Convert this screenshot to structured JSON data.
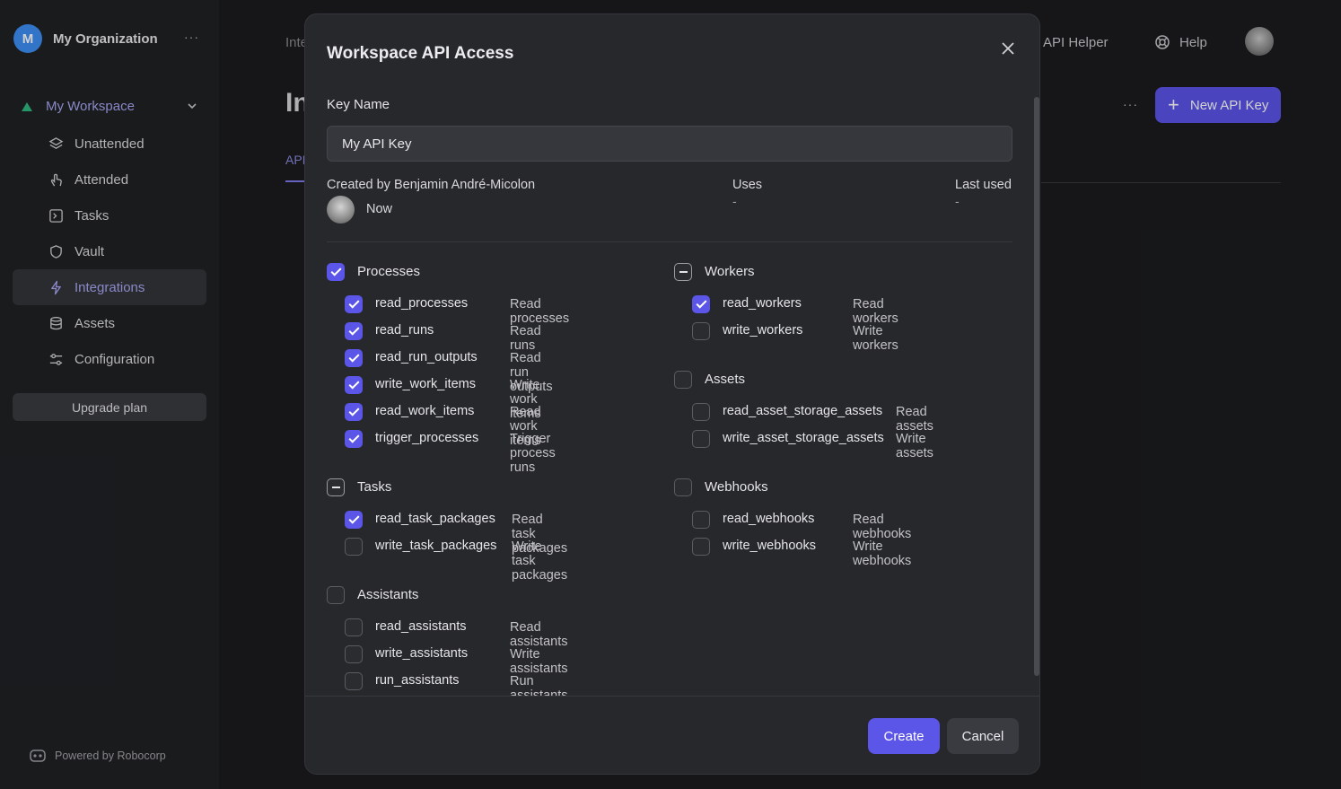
{
  "sidebar": {
    "org_initial": "M",
    "org_name": "My Organization",
    "org_more": "···",
    "workspace": "My Workspace",
    "items": [
      {
        "label": "Unattended",
        "icon": "layers-icon"
      },
      {
        "label": "Attended",
        "icon": "hand-pointer-icon"
      },
      {
        "label": "Tasks",
        "icon": "terminal-icon"
      },
      {
        "label": "Vault",
        "icon": "shield-icon"
      },
      {
        "label": "Integrations",
        "icon": "lightning-icon",
        "active": true
      },
      {
        "label": "Assets",
        "icon": "database-icon"
      },
      {
        "label": "Configuration",
        "icon": "sliders-icon"
      }
    ],
    "upgrade_label": "Upgrade plan",
    "powered_by": "Powered by Robocorp"
  },
  "background": {
    "tab_fragment": "Inte",
    "title_fragment": "In",
    "subtab_fragment": "API",
    "api_helper": "API Helper",
    "help": "Help",
    "more": "···",
    "new_key": "New API Key"
  },
  "modal": {
    "title": "Workspace API Access",
    "key_name_label": "Key Name",
    "key_name_value": "My API Key",
    "created_by": "Created by Benjamin André-Micolon",
    "created_when": "Now",
    "uses_label": "Uses",
    "uses_value": "-",
    "last_used_label": "Last used",
    "last_used_value": "-",
    "groups": {
      "processes": {
        "title": "Processes",
        "state": "checked",
        "perms": [
          {
            "name": "read_processes",
            "desc": "Read processes",
            "checked": true
          },
          {
            "name": "read_runs",
            "desc": "Read runs",
            "checked": true
          },
          {
            "name": "read_run_outputs",
            "desc": "Read run outputs",
            "checked": true
          },
          {
            "name": "write_work_items",
            "desc": "Write work items",
            "checked": true
          },
          {
            "name": "read_work_items",
            "desc": "Read work items",
            "checked": true
          },
          {
            "name": "trigger_processes",
            "desc": "Trigger process runs",
            "checked": true
          }
        ]
      },
      "tasks": {
        "title": "Tasks",
        "state": "indeterminate",
        "perms": [
          {
            "name": "read_task_packages",
            "desc": "Read task packages",
            "checked": true
          },
          {
            "name": "write_task_packages",
            "desc": "Write task packages",
            "checked": false
          }
        ]
      },
      "assistants": {
        "title": "Assistants",
        "state": "unchecked",
        "perms": [
          {
            "name": "read_assistants",
            "desc": "Read assistants",
            "checked": false
          },
          {
            "name": "write_assistants",
            "desc": "Write assistants",
            "checked": false
          },
          {
            "name": "run_assistants",
            "desc": "Run assistants",
            "checked": false
          }
        ]
      },
      "workers": {
        "title": "Workers",
        "state": "indeterminate",
        "perms": [
          {
            "name": "read_workers",
            "desc": "Read workers",
            "checked": true
          },
          {
            "name": "write_workers",
            "desc": "Write workers",
            "checked": false
          }
        ]
      },
      "assets": {
        "title": "Assets",
        "state": "unchecked",
        "perms": [
          {
            "name": "read_asset_storage_assets",
            "desc": "Read assets",
            "checked": false
          },
          {
            "name": "write_asset_storage_assets",
            "desc": "Write assets",
            "checked": false
          }
        ]
      },
      "webhooks": {
        "title": "Webhooks",
        "state": "unchecked",
        "perms": [
          {
            "name": "read_webhooks",
            "desc": "Read webhooks",
            "checked": false
          },
          {
            "name": "write_webhooks",
            "desc": "Write webhooks",
            "checked": false
          }
        ]
      }
    },
    "create_label": "Create",
    "cancel_label": "Cancel"
  },
  "colors": {
    "accent": "#5b55e8",
    "active_text": "#a9a7f4",
    "workspace_icon": "#2fb880",
    "org_avatar": "#3d8ef5"
  }
}
